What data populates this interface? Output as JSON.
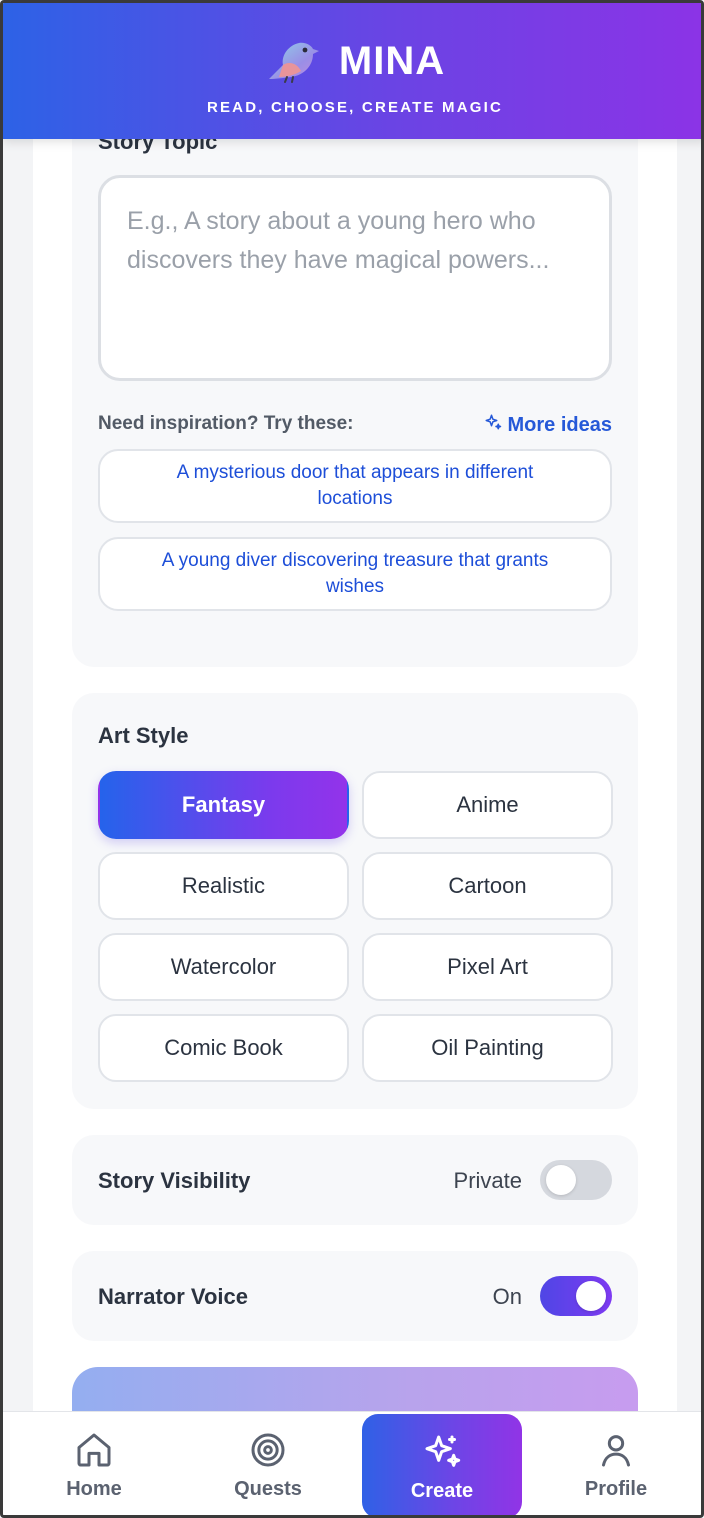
{
  "header": {
    "title": "MINA",
    "tagline": "READ, CHOOSE, CREATE MAGIC",
    "logo_icon": "bird-logo-icon"
  },
  "story_topic": {
    "title": "Story Topic",
    "placeholder": "E.g., A story about a young hero who discovers they have magical powers...",
    "value": "",
    "inspiration_label": "Need inspiration? Try these:",
    "more_ideas_label": "More ideas",
    "suggestions": [
      "A mysterious door that appears in different locations",
      "A young diver discovering treasure that grants wishes"
    ]
  },
  "art_style": {
    "title": "Art Style",
    "options": [
      "Fantasy",
      "Anime",
      "Realistic",
      "Cartoon",
      "Watercolor",
      "Pixel Art",
      "Comic Book",
      "Oil Painting"
    ],
    "selected": "Fantasy"
  },
  "visibility": {
    "label": "Story Visibility",
    "value": "Private",
    "enabled": false
  },
  "narrator": {
    "label": "Narrator Voice",
    "value": "On",
    "enabled": true
  },
  "nav": {
    "items": [
      {
        "label": "Home",
        "icon": "home-icon"
      },
      {
        "label": "Quests",
        "icon": "target-icon"
      },
      {
        "label": "Create",
        "icon": "sparkles-icon"
      },
      {
        "label": "Profile",
        "icon": "user-icon"
      }
    ],
    "active": "Create"
  },
  "colors": {
    "accent_start": "#2563eb",
    "accent_end": "#9333ea",
    "link": "#1d4ed8"
  }
}
